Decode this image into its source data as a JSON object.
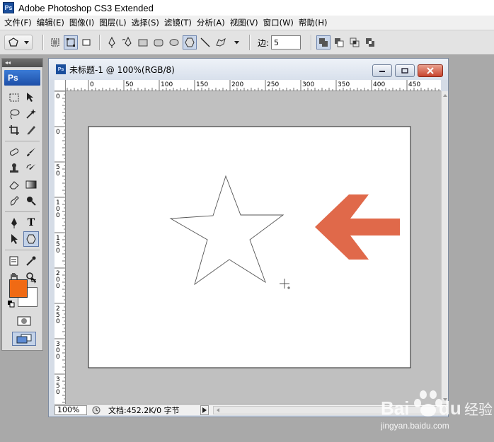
{
  "app": {
    "icon_text": "Ps",
    "title": "Adobe Photoshop CS3 Extended"
  },
  "menu": [
    "文件(F)",
    "编辑(E)",
    "图像(I)",
    "图层(L)",
    "选择(S)",
    "滤镜(T)",
    "分析(A)",
    "视图(V)",
    "窗口(W)",
    "帮助(H)"
  ],
  "options": {
    "sides_label": "边:",
    "sides_value": "5"
  },
  "toolbox": {
    "badge": "Ps",
    "header": "◂◂"
  },
  "colors": {
    "foreground": "#f06a14",
    "background": "#ffffff",
    "arrow": "#e0694a"
  },
  "document": {
    "icon_text": "Ps",
    "title": "未标题-1 @ 100%(RGB/8)",
    "zoom": "100%",
    "info": "文档:452.2K/0 字节",
    "ruler_top": [
      "0",
      "50",
      "100",
      "150",
      "200",
      "250",
      "300",
      "350",
      "400",
      "450"
    ],
    "ruler_left": [
      "0",
      "0",
      "50",
      "100",
      "150",
      "200",
      "250",
      "300",
      "350"
    ]
  },
  "watermark": {
    "brand": "Bai",
    "brand_suffix": "du",
    "product": "经验",
    "url": "jingyan.baidu.com"
  }
}
